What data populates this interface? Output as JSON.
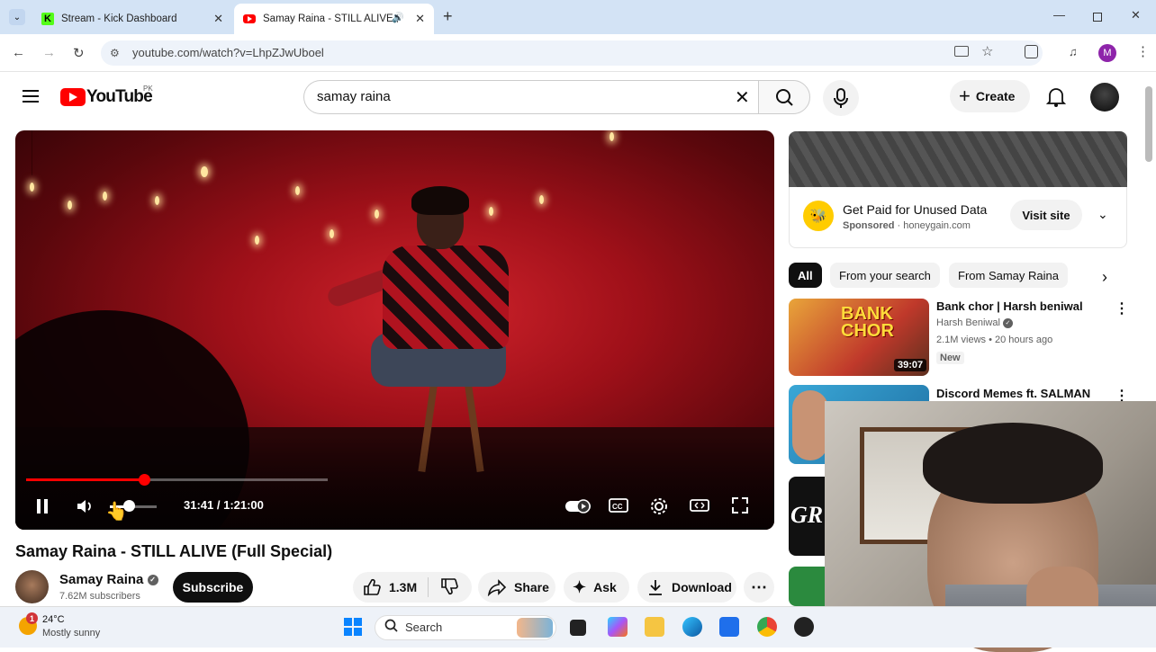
{
  "browser": {
    "tabs": [
      {
        "title": "Stream - Kick Dashboard",
        "favicon": "kick-icon",
        "favicon_color": "#53fc18"
      },
      {
        "title": "Samay Raina - STILL ALIVE (",
        "favicon": "youtube-icon",
        "favicon_color": "#ff0000",
        "active": true,
        "audio": true
      }
    ],
    "url": "youtube.com/watch?v=LhpZJwUboel",
    "profile_letter": "M"
  },
  "youtube": {
    "logo_text": "YouTube",
    "country": "PK",
    "search_query": "samay raina",
    "create_label": "Create"
  },
  "player": {
    "current_time": "31:41",
    "duration": "1:21:00",
    "time_display": "31:41 / 1:21:00",
    "progress_fraction": 0.39,
    "volume_fraction": 0.4,
    "playing": true
  },
  "video_info": {
    "title": "Samay Raina - STILL ALIVE (Full Special)",
    "channel": "Samay Raina",
    "subscribers": "7.62M subscribers",
    "subscribe_label": "Subscribe",
    "likes": "1.3M",
    "share_label": "Share",
    "ask_label": "Ask",
    "download_label": "Download"
  },
  "ad": {
    "title": "Get Paid for Unused Data",
    "sponsored": "Sponsored",
    "domain": "honeygain.com",
    "visit_label": "Visit site"
  },
  "chips": [
    "All",
    "From your search",
    "From Samay Raina"
  ],
  "recommendations": [
    {
      "title": "Bank chor | Harsh beniwal",
      "channel": "Harsh Beniwal",
      "stats": "2.1M views • 20 hours ago",
      "badge": "New",
      "duration": "39:07",
      "thumb_text": "BANK CHOR"
    },
    {
      "title": "Discord Memes ft. SALMAN",
      "thumb_text": ""
    },
    {
      "title": "",
      "thumb_text": "GR"
    }
  ],
  "taskbar": {
    "temperature": "24°C",
    "condition": "Mostly sunny",
    "notification_count": "1",
    "search_label": "Search"
  },
  "colors": {
    "youtube_red": "#ff0000",
    "tab_strip": "#d3e3f5",
    "omnibox": "#eef3fa",
    "progress": "#ff0000",
    "chip_active_bg": "#0f0f0f",
    "windows_blue": "#0a84ff"
  }
}
